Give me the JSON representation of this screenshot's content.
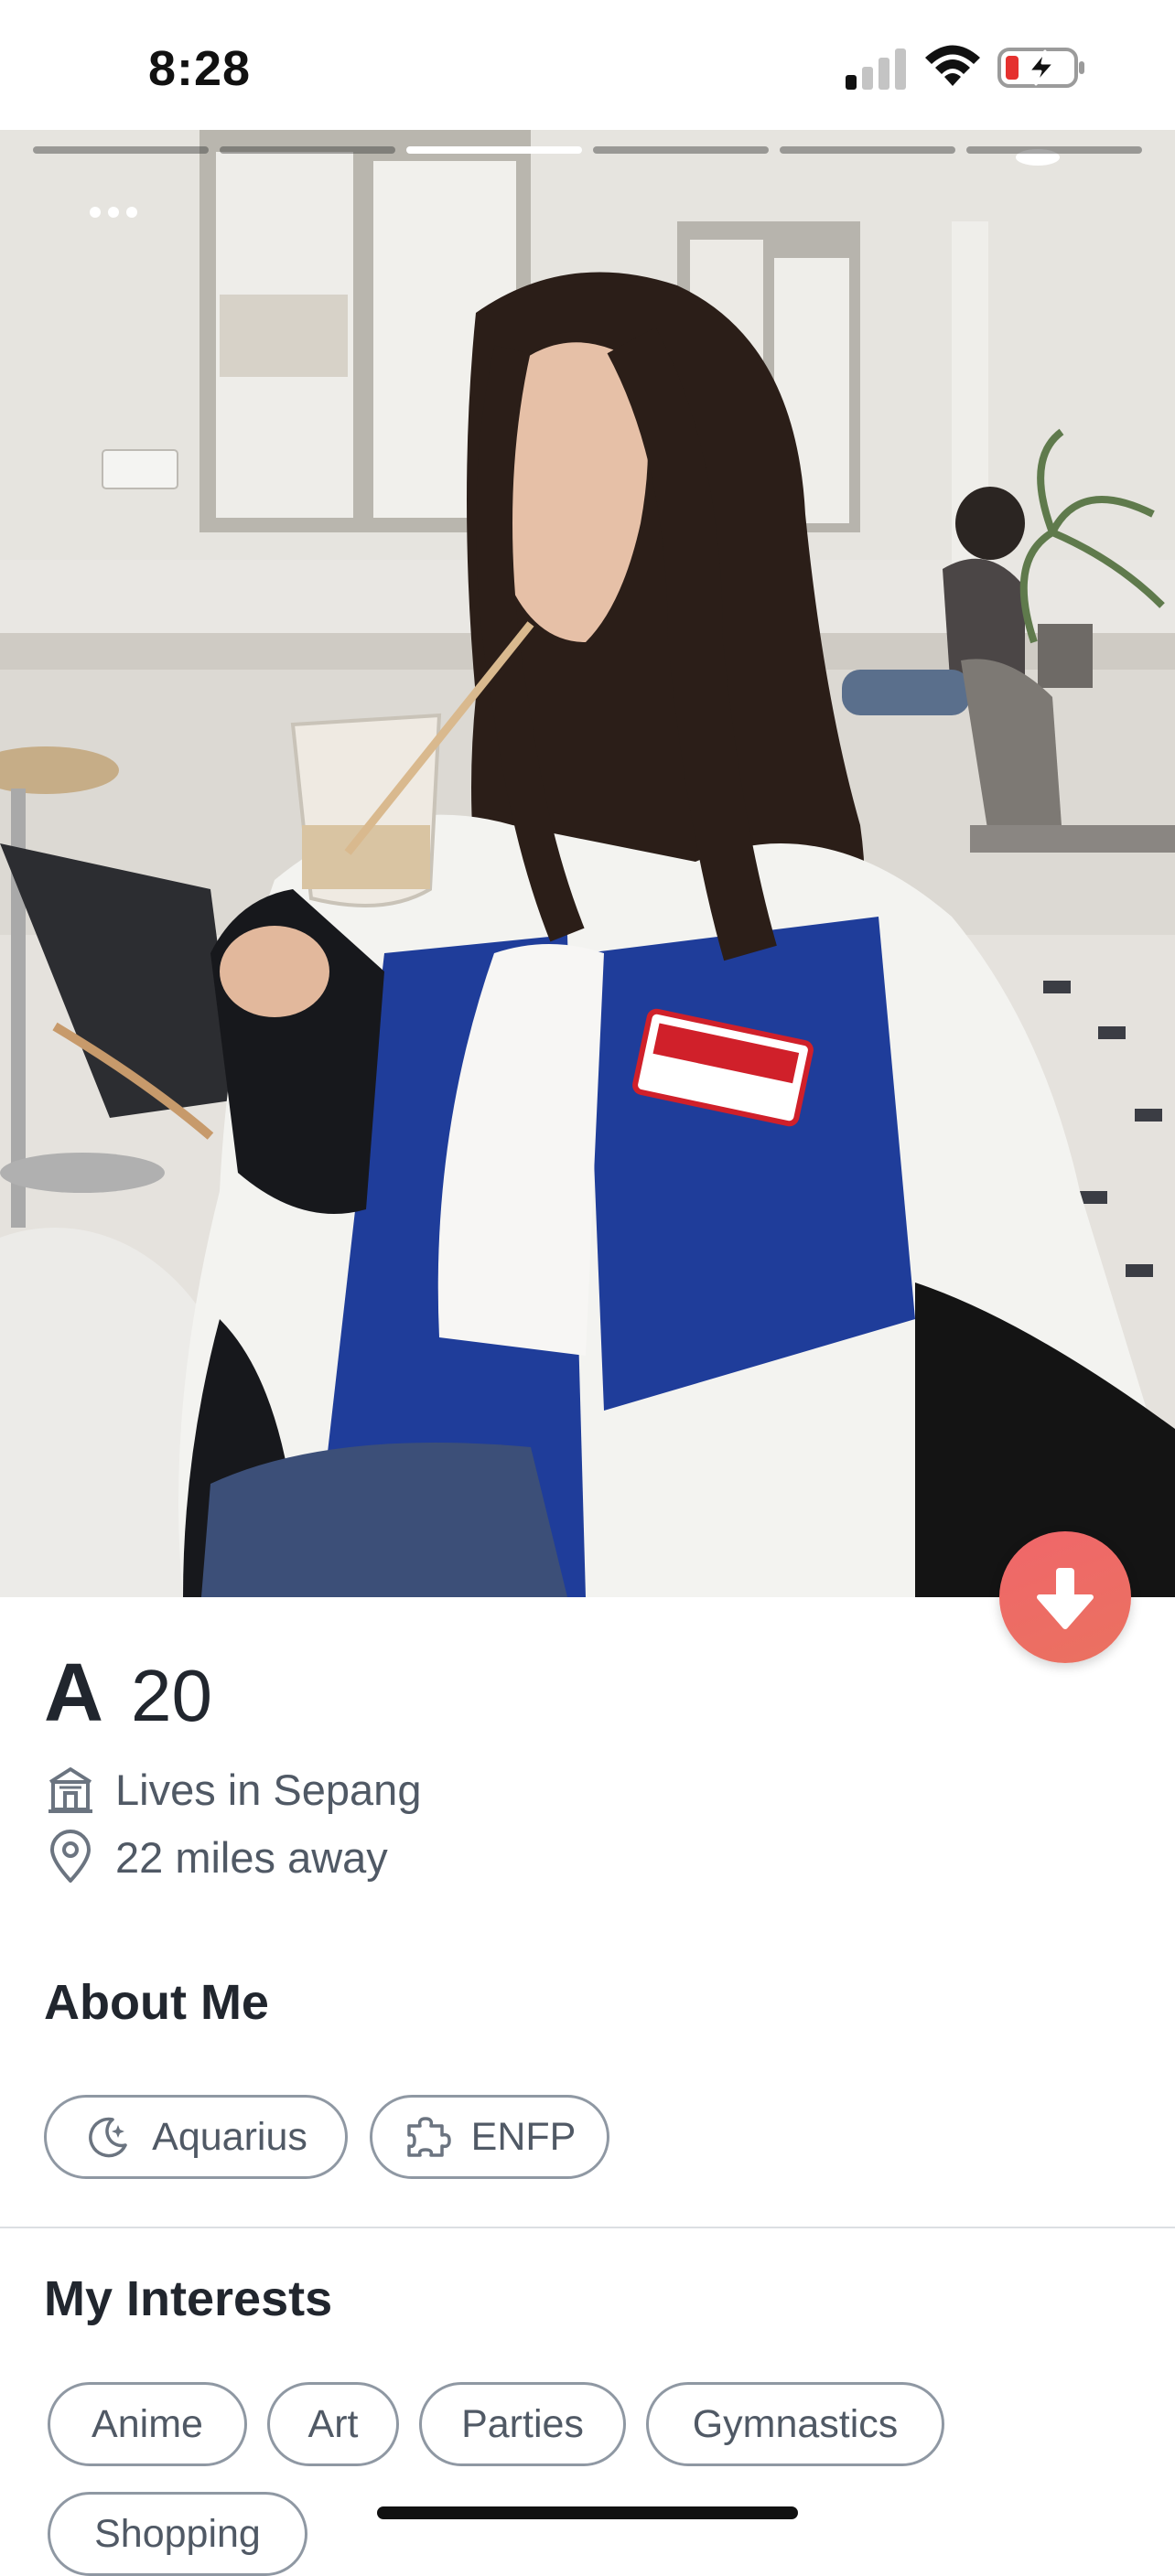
{
  "status_bar": {
    "time": "8:28",
    "signal_icon": "cellular-signal-icon",
    "wifi_icon": "wifi-icon",
    "battery_icon": "battery-charging-low-icon"
  },
  "photo": {
    "progress_segments": 6,
    "active_segment": 3,
    "more_icon": "ellipsis-icon"
  },
  "down_button_icon": "arrow-down-icon",
  "profile": {
    "name": "A",
    "age": "20",
    "lives_in": "Lives in Sepang",
    "distance": "22 miles away"
  },
  "about_me": {
    "title": "About Me",
    "chips": [
      {
        "label": "Aquarius",
        "icon": "moon-stars-icon"
      },
      {
        "label": "ENFP",
        "icon": "puzzle-piece-icon"
      }
    ]
  },
  "interests": {
    "title": "My Interests",
    "chips": [
      "Anime",
      "Art",
      "Parties",
      "Gymnastics",
      "Shopping"
    ]
  },
  "colors": {
    "accent": "#EE6A66",
    "text_primary": "#21262E",
    "text_secondary": "#505965",
    "chip_border": "#8F98A3"
  }
}
